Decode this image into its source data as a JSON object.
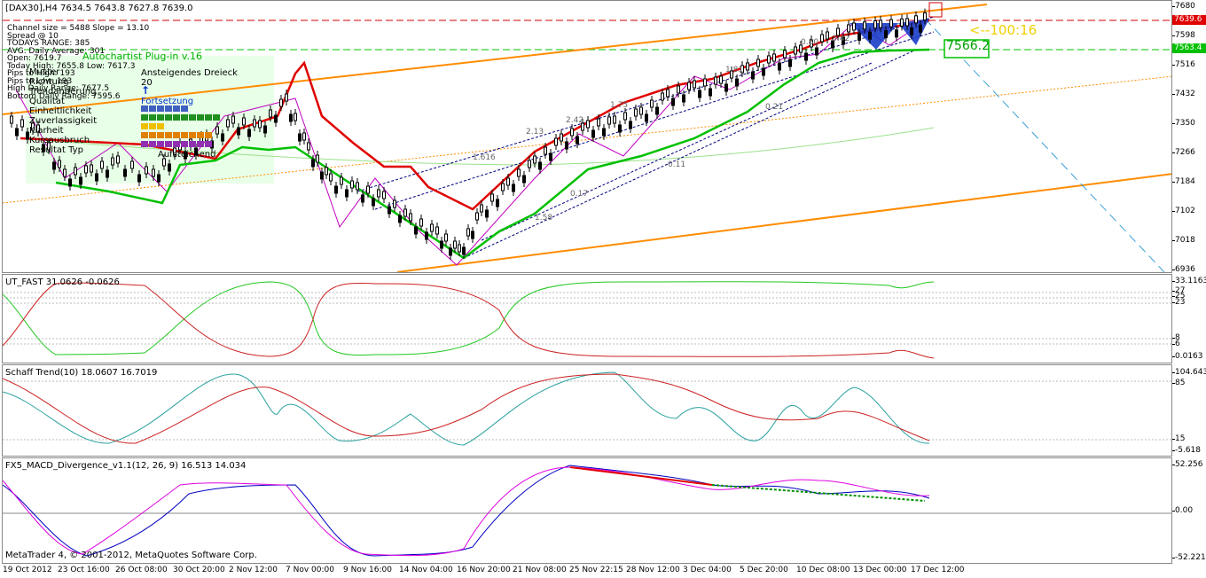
{
  "main": {
    "header": "[DAX30],H4  7634.5 7643.8 7627.8 7639.0",
    "info_lines": [
      "Channel size = 5488 Slope = 13.10",
      "Spread @ 10",
      "TODAYS RANGE: 385",
      "AVG. Daily Average: 301",
      "Open: 7619.7",
      "Today High: 7655.8  Low: 7617.3",
      "Pips to High: 193",
      "Pips to Low: 193",
      "High Daily Range: 7677.5",
      "Bottom Daily Range: 7595.6"
    ],
    "overlap_labels": [
      "Muster",
      "Richtung",
      "Trendanderung",
      "Qualitat",
      "Einheitlichkeit",
      "Zuverlassigkeit",
      "Klarheit",
      "Kursausbruch",
      "Resultat Typ"
    ],
    "plugin_title": "Autochartist Plug-in v.16",
    "pattern_name": "Ansteigendes Dreieck",
    "pattern_value": "20",
    "direction_arrow": "↑",
    "direction_label": "Fortsetzung",
    "result_label": "Aufsteichend",
    "countdown": "<--100:16",
    "price_box": "7566.2",
    "fib_labels": [
      "0.80",
      "1.81",
      "2.42",
      "2.13",
      "1.75",
      "0.21",
      "3.42",
      "0.17",
      "1.58",
      "1.616",
      "0.11"
    ],
    "price_axis": [
      "7680",
      "7598",
      "7516",
      "7432",
      "7350",
      "7266",
      "7184",
      "7102",
      "7018",
      "6936"
    ],
    "current_price_tag": "7639.6",
    "green_price_tag": "7563.4",
    "colors": {
      "bull": "#00c000",
      "bear": "#e00000",
      "channel": "#ff8c00",
      "fib": "#000080"
    }
  },
  "ut_fast": {
    "title": "UT_FAST 31.0626 -0.0626",
    "axis": [
      "33.1163",
      "27",
      "25",
      "23",
      "8",
      "6",
      "0.0163"
    ]
  },
  "schaff": {
    "title": "Schaff Trend(10) 18.0607 16.7019",
    "axis": [
      "104.643",
      "85",
      "15",
      "-5.618"
    ]
  },
  "macd": {
    "title": "FX5_MACD_Divergence_v1.1(12, 26, 9) 16.513 14.034",
    "axis": [
      "52.256",
      "0.00",
      "-52.221"
    ],
    "copyright": "MetaTrader 4, © 2001-2012, MetaQuotes Software Corp."
  },
  "time_axis": [
    "19 Oct 2012",
    "23 Oct 16:00",
    "26 Oct 08:00",
    "30 Oct 20:00",
    "2 Nov 12:00",
    "7 Nov 00:00",
    "9 Nov 16:00",
    "14 Nov 04:00",
    "16 Nov 20:00",
    "21 Nov 08:00",
    "25 Nov 22:15",
    "28 Nov 12:00",
    "3 Dec 04:00",
    "5 Dec 20:00",
    "10 Dec 08:00",
    "13 Dec 00:00",
    "17 Dec 12:00"
  ]
}
